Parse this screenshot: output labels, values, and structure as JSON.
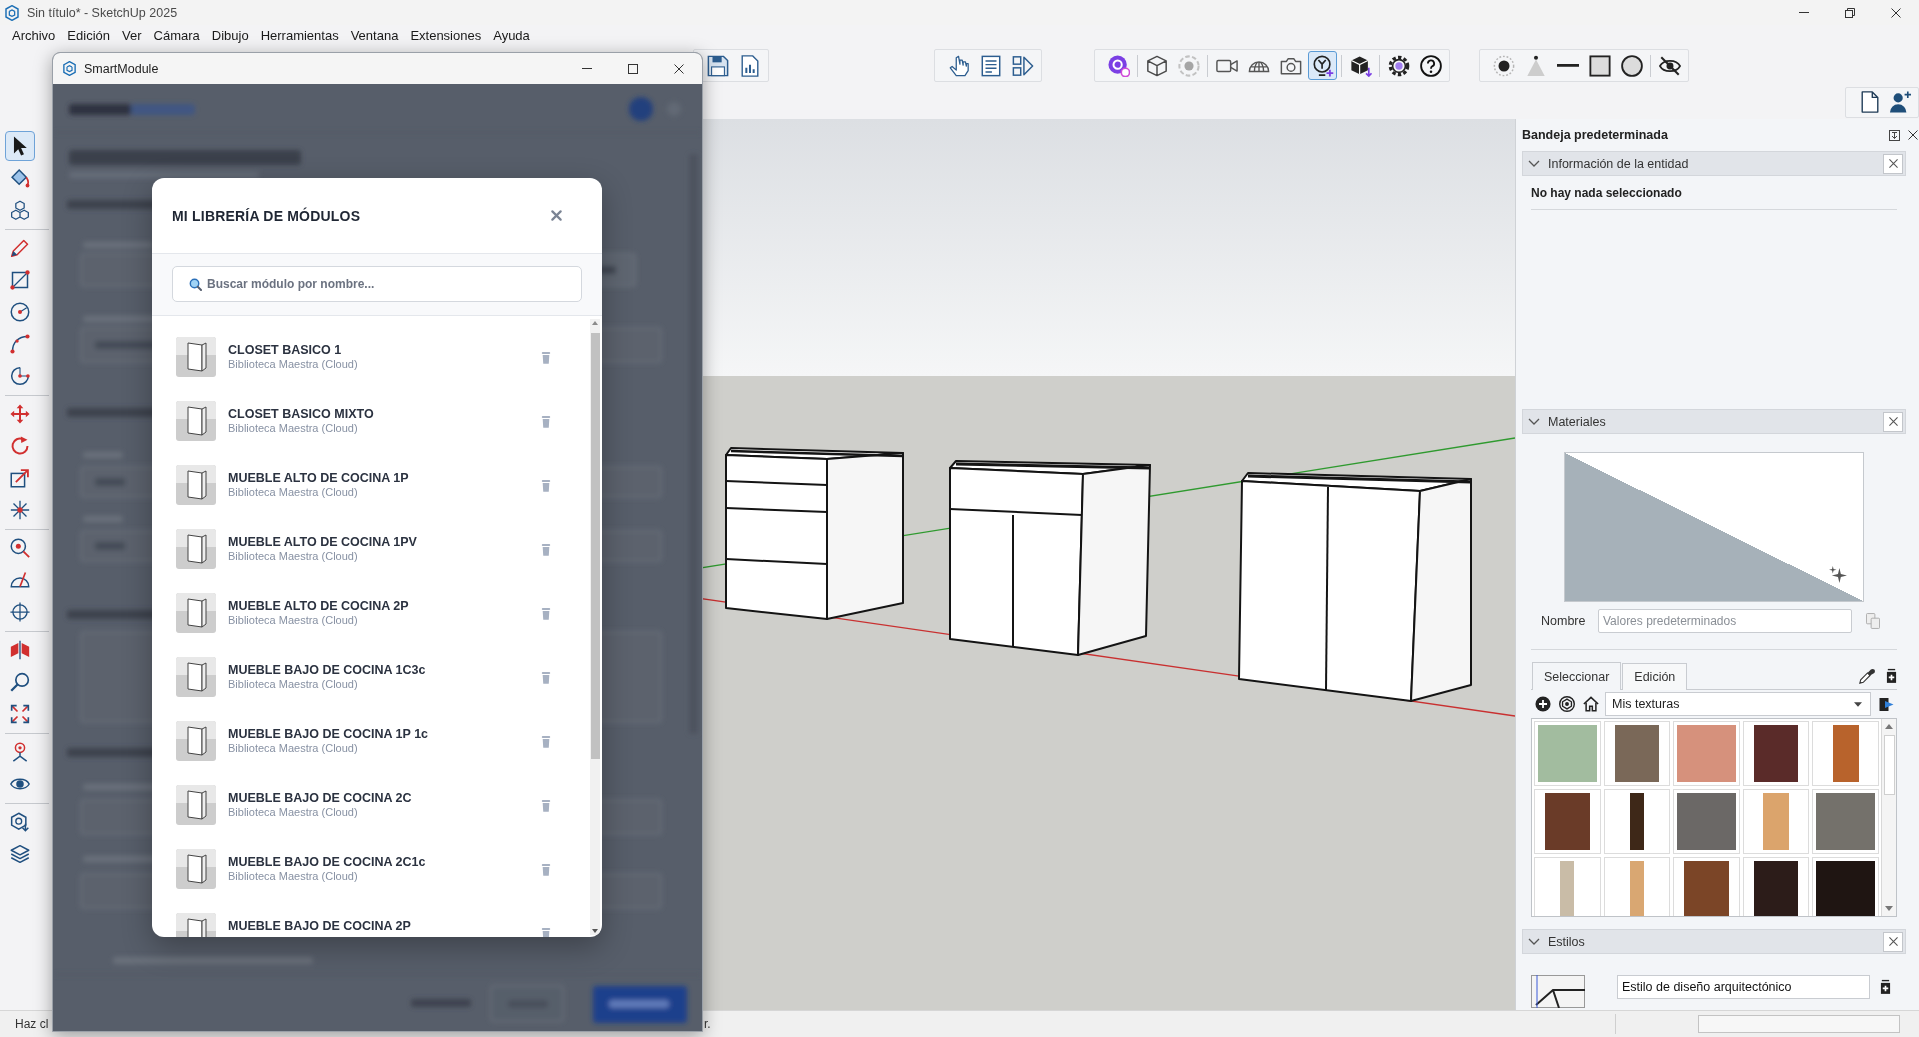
{
  "window": {
    "title": "Sin título* - SketchUp 2025"
  },
  "menu": [
    "Archivo",
    "Edición",
    "Ver",
    "Cámara",
    "Dibujo",
    "Herramientas",
    "Ventana",
    "Extensiones",
    "Ayuda"
  ],
  "toolbars": [
    {
      "sections": [
        {
          "buttons": [
            {
              "kind": "save",
              "selected": false
            },
            {
              "kind": "report",
              "selected": false
            }
          ]
        }
      ]
    },
    {
      "sections": [
        {
          "buttons": [
            {
              "kind": "hand",
              "selected": false
            },
            {
              "kind": "list",
              "selected": false
            },
            {
              "kind": "panel_play",
              "selected": false
            }
          ]
        }
      ]
    },
    {
      "sections": [
        {
          "buttons": [
            {
              "kind": "disc_badge",
              "selected": false
            }
          ]
        },
        {
          "buttons": [
            {
              "kind": "cube",
              "selected": false
            },
            {
              "kind": "target",
              "selected": false
            }
          ]
        },
        {
          "buttons": [
            {
              "kind": "video",
              "selected": false
            },
            {
              "kind": "dome",
              "selected": false
            },
            {
              "kind": "camera",
              "selected": false
            },
            {
              "kind": "fork_plus",
              "selected": true
            }
          ]
        },
        {
          "buttons": [
            {
              "kind": "cube_down",
              "selected": false
            }
          ]
        },
        {
          "buttons": [
            {
              "kind": "gear",
              "selected": false
            },
            {
              "kind": "help",
              "selected": false
            }
          ]
        }
      ]
    },
    {
      "sections": [
        {
          "buttons": [
            {
              "kind": "dot_circle",
              "selected": false
            },
            {
              "kind": "cone",
              "selected": false
            },
            {
              "kind": "line",
              "selected": false
            },
            {
              "kind": "square",
              "selected": false
            },
            {
              "kind": "circle_fill",
              "selected": false
            }
          ]
        },
        {
          "buttons": [
            {
              "kind": "eye_slash",
              "selected": false
            }
          ]
        }
      ]
    }
  ],
  "quick_toolbar": {
    "buttons": [
      {
        "kind": "page",
        "selected": false
      },
      {
        "kind": "user_add",
        "selected": false
      }
    ]
  },
  "tool_palette": {
    "sections": [
      {
        "tools": [
          {
            "kind": "select",
            "selected": true
          },
          {
            "kind": "paint",
            "selected": false
          },
          {
            "kind": "components",
            "selected": false
          }
        ]
      },
      {
        "tools": [
          {
            "kind": "pencil",
            "selected": false
          },
          {
            "kind": "rectangle",
            "selected": false
          },
          {
            "kind": "circle",
            "selected": false
          },
          {
            "kind": "arc",
            "selected": false
          },
          {
            "kind": "pie",
            "selected": false
          }
        ]
      },
      {
        "tools": [
          {
            "kind": "move",
            "selected": false
          },
          {
            "kind": "rotate",
            "selected": false
          },
          {
            "kind": "scale",
            "selected": false
          },
          {
            "kind": "asterisk",
            "selected": false
          }
        ]
      },
      {
        "tools": [
          {
            "kind": "tape",
            "selected": false
          },
          {
            "kind": "protractor",
            "selected": false
          },
          {
            "kind": "axes",
            "selected": false
          }
        ]
      },
      {
        "tools": [
          {
            "kind": "section",
            "selected": false
          },
          {
            "kind": "zoom",
            "selected": false
          },
          {
            "kind": "zoom_extents",
            "selected": false
          }
        ]
      },
      {
        "tools": [
          {
            "kind": "position_camera",
            "selected": false
          },
          {
            "kind": "look_around",
            "selected": false
          }
        ]
      },
      {
        "tools": [
          {
            "kind": "hexagon",
            "selected": false
          },
          {
            "kind": "layers",
            "selected": false
          }
        ]
      }
    ]
  },
  "smartmodule": {
    "title": "SmartModule",
    "library": {
      "title": "MI LIBRERÍA DE MÓDULOS",
      "search": {
        "placeholder": "Buscar módulo por nombre..."
      },
      "modules": [
        {
          "name": "CLOSET BASICO 1",
          "source": "Biblioteca Maestra (Cloud)"
        },
        {
          "name": "CLOSET BASICO MIXTO",
          "source": "Biblioteca Maestra (Cloud)"
        },
        {
          "name": "MUEBLE ALTO DE COCINA 1P",
          "source": "Biblioteca Maestra (Cloud)"
        },
        {
          "name": "MUEBLE ALTO DE COCINA 1PV",
          "source": "Biblioteca Maestra (Cloud)"
        },
        {
          "name": "MUEBLE ALTO DE COCINA 2P",
          "source": "Biblioteca Maestra (Cloud)"
        },
        {
          "name": "MUEBLE BAJO DE COCINA 1C3c",
          "source": "Biblioteca Maestra (Cloud)"
        },
        {
          "name": "MUEBLE BAJO DE COCINA 1P 1c",
          "source": "Biblioteca Maestra (Cloud)"
        },
        {
          "name": "MUEBLE BAJO DE COCINA 2C",
          "source": "Biblioteca Maestra (Cloud)"
        },
        {
          "name": "MUEBLE BAJO DE COCINA 2C1c",
          "source": "Biblioteca Maestra (Cloud)"
        },
        {
          "name": "MUEBLE BAJO DE COCINA 2P"
        }
      ]
    }
  },
  "tray": {
    "title": "Bandeja predeterminada",
    "sections": [
      {
        "kind": "entity",
        "title": "Información de la entidad",
        "expanded": true,
        "message": "No hay nada seleccionado"
      },
      {
        "kind": "materials",
        "title": "Materiales",
        "expanded": true,
        "name_label": "Nombre",
        "name_placeholder": "Valores predeterminados",
        "tabs": [
          {
            "label": "Seleccionar",
            "selected": true
          },
          {
            "label": "Edición",
            "selected": false
          }
        ],
        "collection": "Mis texturas",
        "swatches": [
          {
            "color": "#a2bc9f",
            "kind": "full"
          },
          {
            "color": "#7a6858",
            "kind": "wide"
          },
          {
            "color": "#d6917c",
            "kind": "full"
          },
          {
            "color": "#5a2b29",
            "kind": "wide"
          },
          {
            "color": "#b8632c",
            "kind": "half"
          },
          {
            "color": "#6a3b28",
            "kind": "wide"
          },
          {
            "color": "#3e2818",
            "kind": "narrow"
          },
          {
            "color": "#6b6866",
            "kind": "full"
          },
          {
            "color": "#dba46c",
            "kind": "half"
          },
          {
            "color": "#74716b",
            "kind": "full"
          },
          {
            "color": "#c9bca7",
            "kind": "narrow"
          },
          {
            "color": "#d9a772",
            "kind": "narrow"
          },
          {
            "color": "#7b4527",
            "kind": "wide"
          },
          {
            "color": "#2c1c19",
            "kind": "wide"
          },
          {
            "color": "#1f1512",
            "kind": "full"
          }
        ]
      },
      {
        "kind": "styles",
        "title": "Estilos",
        "expanded": true,
        "style_name": "Estilo de diseño arquitectónico"
      }
    ]
  },
  "status_bar": {
    "hint": "Haz cl",
    "hint_tail": "r."
  }
}
